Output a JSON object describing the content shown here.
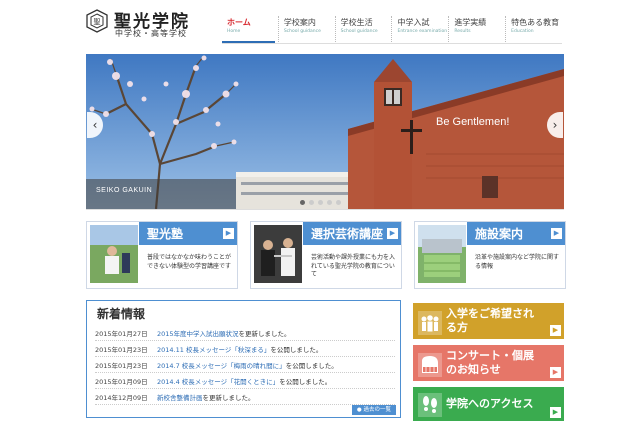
{
  "header": {
    "logo_name": "聖光学院",
    "logo_sub": "中学校・高等学校"
  },
  "nav": [
    {
      "ja": "ホーム",
      "en": "Home"
    },
    {
      "ja": "学校案内",
      "en": "School guidance"
    },
    {
      "ja": "学校生活",
      "en": "School guidance"
    },
    {
      "ja": "中学入試",
      "en": "Entrance examination"
    },
    {
      "ja": "進学実績",
      "en": "Results"
    },
    {
      "ja": "特色ある教育",
      "en": "Education"
    }
  ],
  "hero": {
    "caption": "Be Gentlemen!",
    "seiko": "SEIKO GAKUIN",
    "prev": "‹",
    "next": "›",
    "dot_count": 5,
    "active_dot": 1
  },
  "cards": [
    {
      "title": "聖光塾",
      "desc": "普段ではなかなか味わうことができない体験型の学習講座です",
      "go": "▶"
    },
    {
      "title": "選択芸術講座",
      "desc": "芸術活動や課外授業にも力を入れている聖光学院の教育について",
      "go": "▶"
    },
    {
      "title": "施設案内",
      "desc": "沿革や施設案内など学院に関する情報",
      "go": "▶"
    }
  ],
  "news": {
    "title": "新着情報",
    "items": [
      {
        "date": "2015年01月27日",
        "link": "2015年度中学入試出願状況",
        "rest": "を更新しました。"
      },
      {
        "date": "2015年01月23日",
        "link": "2014.11 校長メッセージ「秋深まる」",
        "rest": "を公開しました。"
      },
      {
        "date": "2015年01月23日",
        "link": "2014.7 校長メッセージ「梅雨の晴れ間に」",
        "rest": "を公開しました。"
      },
      {
        "date": "2015年01月09日",
        "link": "2014.4 校長メッセージ「花開くときに」",
        "rest": "を公開しました。"
      },
      {
        "date": "2014年12月09日",
        "link": "新校舎整備計画",
        "rest": "を更新しました。"
      }
    ],
    "more": "過去の一覧"
  },
  "side": [
    {
      "line1": "入学をご希望され",
      "line2": "る方",
      "color": "#d1a12a"
    },
    {
      "line1": "コンサート・個展",
      "line2": "のお知らせ",
      "color": "#e67668"
    },
    {
      "line1": "学院へのアクセス",
      "line2": "",
      "color": "#3aab4f"
    }
  ],
  "colors": {
    "accent": "#4e8fd1",
    "nav_active": "#d7262c"
  }
}
